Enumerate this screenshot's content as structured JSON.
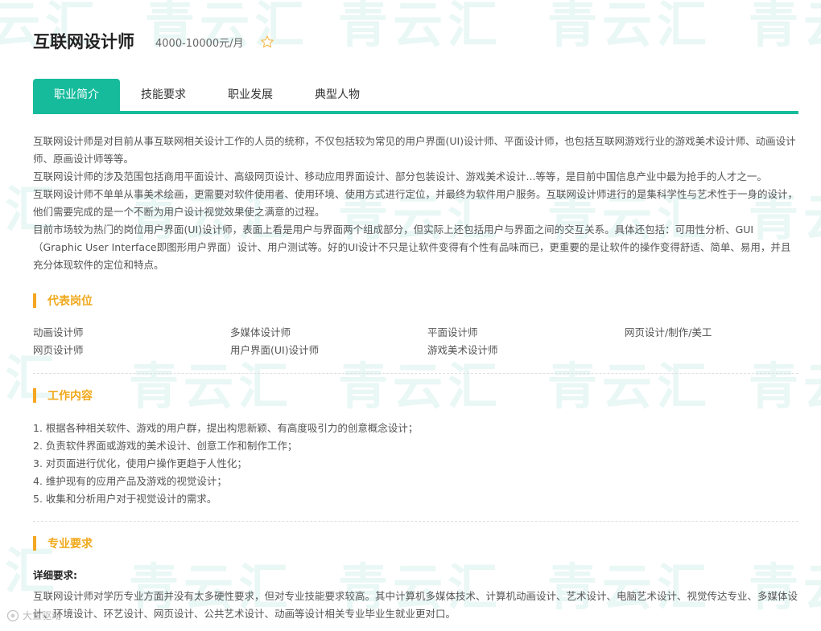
{
  "header": {
    "title": "互联网设计师",
    "salary": "4000-10000元/月"
  },
  "tabs": [
    {
      "label": "职业简介"
    },
    {
      "label": "技能要求"
    },
    {
      "label": "职业发展"
    },
    {
      "label": "典型人物"
    }
  ],
  "intro": {
    "paragraphs": [
      "互联网设计师是对目前从事互联网相关设计工作的人员的统称，不仅包括较为常见的用户界面(UI)设计师、平面设计师，也包括互联网游戏行业的游戏美术设计师、动画设计师、原画设计师等等。",
      "互联网设计师的涉及范围包括商用平面设计、高级网页设计、移动应用界面设计、部分包装设计、游戏美术设计...等等，是目前中国信息产业中最为抢手的人才之一。",
      "互联网设计师不单单从事美术绘画，更需要对软件使用者、使用环境、使用方式进行定位，并最终为软件用户服务。互联网设计师进行的是集科学性与艺术性于一身的设计，他们需要完成的是一个不断为用户设计视觉效果使之满意的过程。",
      "目前市场较为热门的岗位用户界面(UI)设计师，表面上看是用户与界面两个组成部分，但实际上还包括用户与界面之间的交互关系。具体还包括：可用性分析、GUI（Graphic User Interface即图形用户界面）设计、用户测试等。好的UI设计不只是让软件变得有个性有品味而已，更重要的是让软件的操作变得舒适、简单、易用，并且充分体现软件的定位和特点。"
    ]
  },
  "sections": {
    "positions_title": "代表岗位",
    "work_title": "工作内容",
    "major_title": "专业要求"
  },
  "positions": [
    "动画设计师",
    "多媒体设计师",
    "平面设计师",
    "网页设计/制作/美工",
    "网页设计师",
    "用户界面(UI)设计师",
    "游戏美术设计师"
  ],
  "work_items": [
    "1. 根据各种相关软件、游戏的用户群，提出构思新颖、有高度吸引力的创意概念设计；",
    "2. 负责软件界面或游戏的美术设计、创意工作和制作工作；",
    "3. 对页面进行优化，使用户操作更趋于人性化；",
    "4. 维护现有的应用产品及游戏的视觉设计；",
    "5. 收集和分析用户对于视觉设计的需求。"
  ],
  "major": {
    "label": "详细要求:",
    "text": "互联网设计师对学历专业方面并没有太多硬性要求，但对专业技能要求较高。其中计算机多媒体技术、计算机动画设计、艺术设计、电脑艺术设计、视觉传达专业、多媒体设计、环境设计、环艺设计、网页设计、公共艺术设计、动画等设计相关专业毕业生就业更对口。"
  },
  "watermark": {
    "text": "青云汇"
  },
  "corner": {
    "text": "大鱼驱动"
  },
  "colors": {
    "accent": "#16bb9c",
    "section": "#f5a623",
    "watermark": "#c7ece6"
  }
}
